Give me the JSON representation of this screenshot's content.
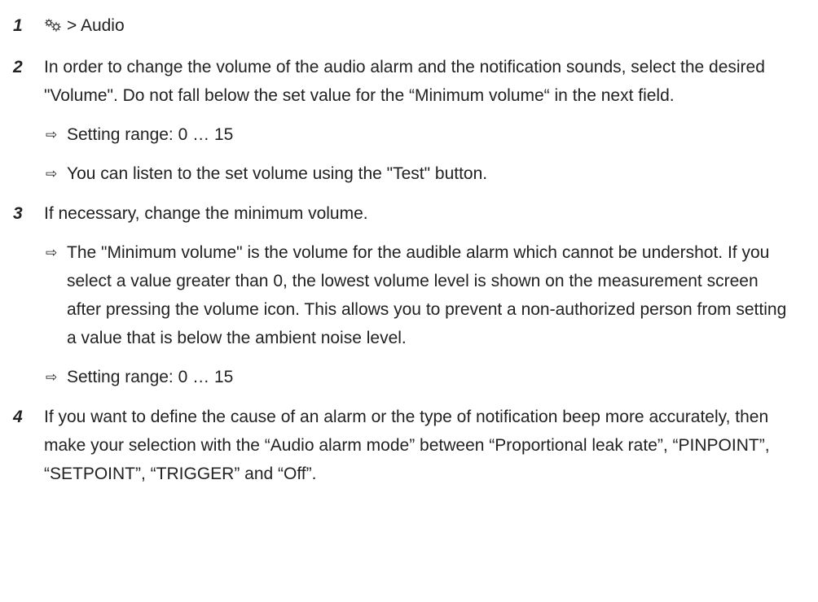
{
  "steps": [
    {
      "number": "1",
      "icon": "settings-gears-icon",
      "text": "> Audio",
      "results": []
    },
    {
      "number": "2",
      "text": "In order to change the volume of the audio alarm and the notification sounds, select the desired \"Volume\". Do not fall below the set value for the “Minimum volume“ in the next field.",
      "results": [
        "Setting range: 0 … 15",
        "You can listen to the set volume using the \"Test\" button."
      ]
    },
    {
      "number": "3",
      "text": "If necessary, change the minimum volume.",
      "results": [
        "The \"Minimum volume\" is the volume for the audible alarm which cannot be undershot. If you select a value greater than 0, the lowest volume level is shown on the measurement screen after pressing the volume icon. This allows you to prevent a non-authorized person from setting a value that is below the ambient noise level.",
        "Setting range: 0 … 15"
      ]
    },
    {
      "number": "4",
      "text": "If you want to define the cause of an alarm or the type of notification beep more accurately, then make your selection with the “Audio alarm mode” between “Proportional leak rate”, “PINPOINT”, “SETPOINT”, “TRIGGER” and “Off”.",
      "results": []
    }
  ],
  "result_marker": "⇨"
}
